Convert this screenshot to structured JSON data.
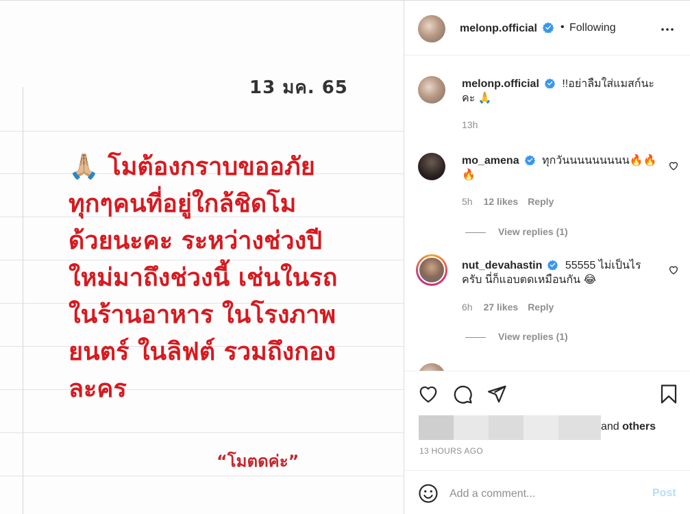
{
  "post_image": {
    "date": "13 มค. 65",
    "body": "🙏🏼 โมต้องกราบขออภัย\nทุกๆคนที่อยู่ใกล้ชิดโม\nด้วยนะคะ ระหว่างช่วงปี\nใหม่มาถึงช่วงนี้ เช่นในรถ\nในร้านอาหาร ในโรงภาพ\nยนตร์ ในลิฟต์ รวมถึงกอง\nละคร",
    "signature": "“โมตดค่ะ”"
  },
  "header": {
    "username": "melonp.official",
    "dot": "•",
    "follow_status": "Following"
  },
  "caption": {
    "username": "melonp.official",
    "text": "!!อย่าลืมใส่แมสก์นะคะ 🙏",
    "time": "13h"
  },
  "comments": [
    {
      "username": "mo_amena",
      "text": "ทุกวันนนนนนนนน🔥🔥🔥",
      "time": "5h",
      "likes": "12 likes",
      "reply": "Reply",
      "view_replies": "View replies (1)"
    },
    {
      "username": "nut_devahastin",
      "text": "55555 ไม่เป็นไรครับ นี่ก็แอบตดเหมือนกัน 😂",
      "time": "6h",
      "likes": "27 likes",
      "reply": "Reply",
      "view_replies": "View replies (1)"
    }
  ],
  "actions": {
    "liked_by_suffix": "and",
    "liked_by_others": "others",
    "timestamp": "13 HOURS AGO"
  },
  "add_comment": {
    "placeholder": "Add a comment...",
    "post_label": "Post"
  },
  "colors": {
    "post_text": "#d7191f",
    "verified": "#3897f0",
    "post_button_disabled": "#b2dffc",
    "muted": "#8e8e8e"
  },
  "icons": [
    "more-icon",
    "verified-icon",
    "heart-icon",
    "comment-icon",
    "share-icon",
    "bookmark-icon",
    "emoji-icon"
  ]
}
